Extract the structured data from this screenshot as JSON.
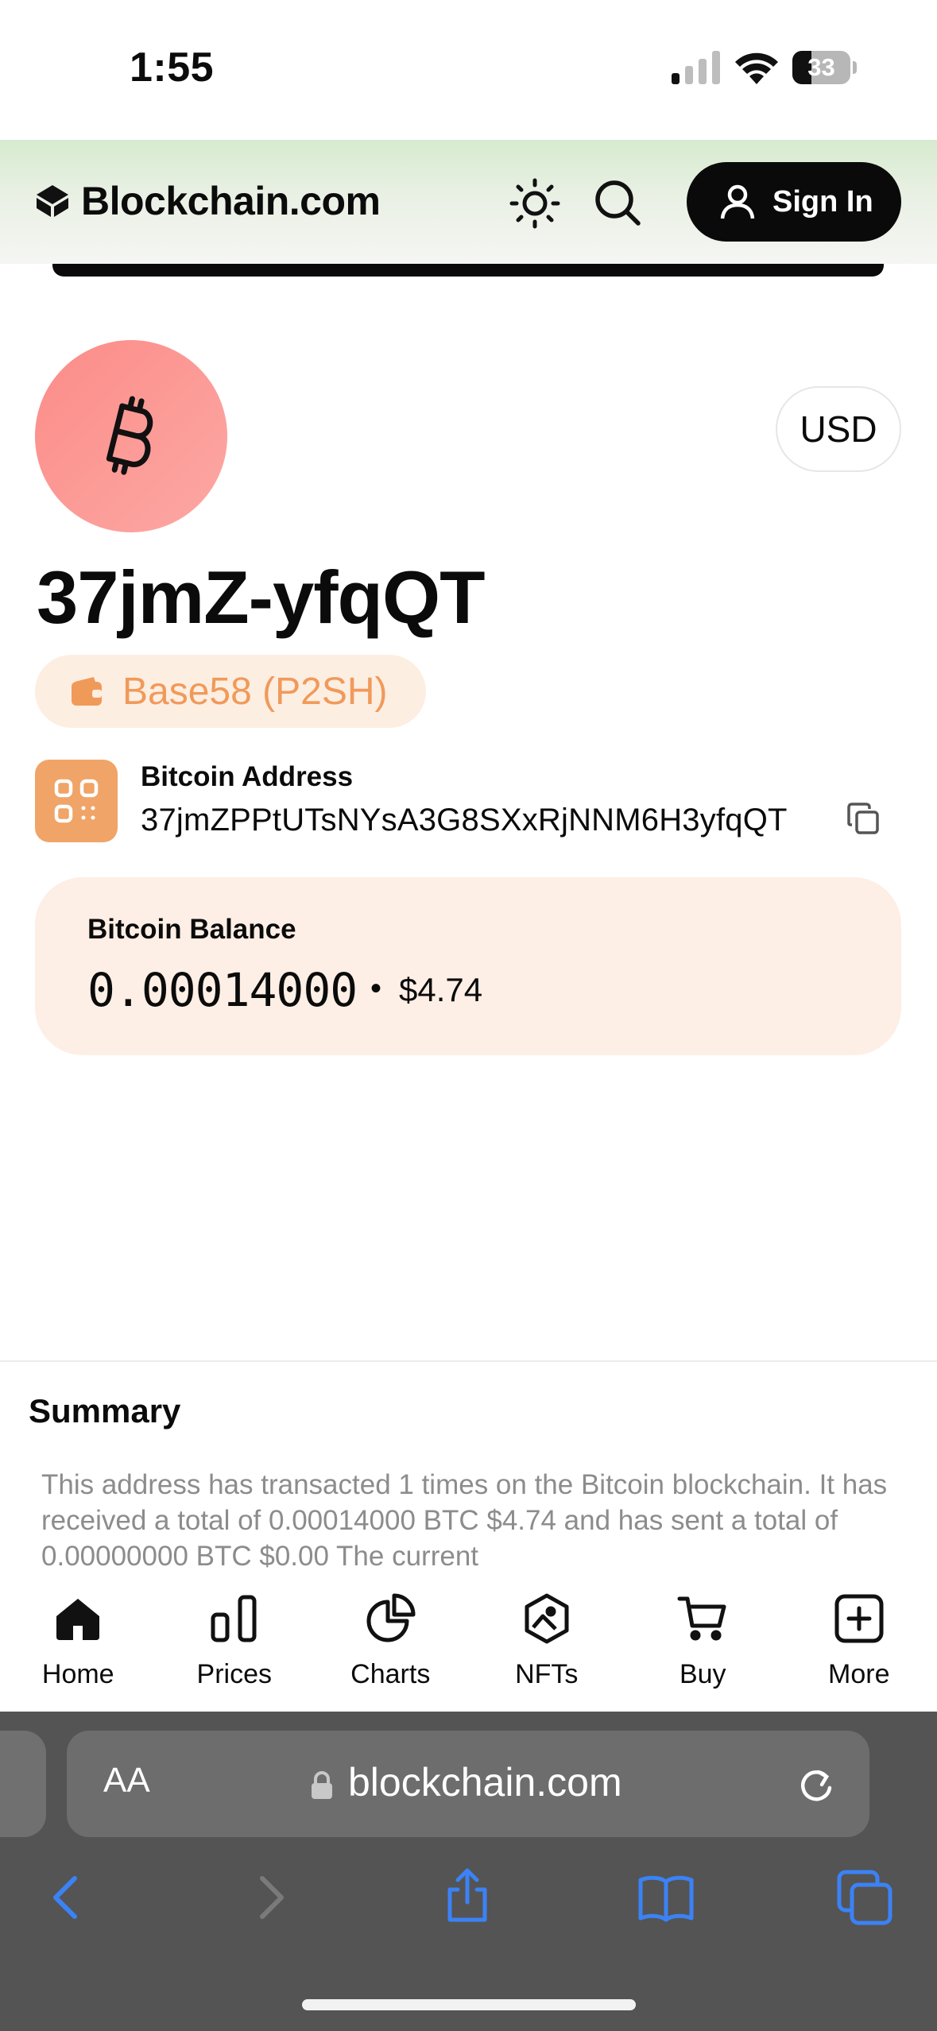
{
  "status_bar": {
    "time": "1:55",
    "battery": "33",
    "battery_level": 0.33
  },
  "header": {
    "logo_text": "Blockchain.com",
    "signin_label": "Sign In"
  },
  "address": {
    "short_title": "37jmZ-yfqQT",
    "type_label": "Base58 (P2SH)",
    "full_label": "Bitcoin Address",
    "full_value": "37jmZPPtUTsNYsA3G8SXxRjNNM6H3yfqQT",
    "currency": "USD"
  },
  "balance": {
    "label": "Bitcoin Balance",
    "btc": "0.00014000",
    "separator": "•",
    "usd": "$4.74"
  },
  "summary": {
    "title": "Summary",
    "text": "This address has transacted 1 times on the Bitcoin blockchain. It has received a total of 0.00014000 BTC $4.74 and has sent a total of 0.00000000 BTC $0.00 The current"
  },
  "bottom_nav": {
    "items": [
      {
        "label": "Home",
        "icon": "home-icon"
      },
      {
        "label": "Prices",
        "icon": "bar-chart-icon"
      },
      {
        "label": "Charts",
        "icon": "pie-chart-icon"
      },
      {
        "label": "NFTs",
        "icon": "nft-icon"
      },
      {
        "label": "Buy",
        "icon": "cart-icon"
      },
      {
        "label": "More",
        "icon": "plus-square-icon"
      }
    ]
  },
  "browser": {
    "text_size_label": "AA",
    "url": "blockchain.com"
  },
  "colors": {
    "accent_orange": "#f09a5a",
    "coin_red": "#fb8c88",
    "safari_blue": "#3b82f6"
  }
}
